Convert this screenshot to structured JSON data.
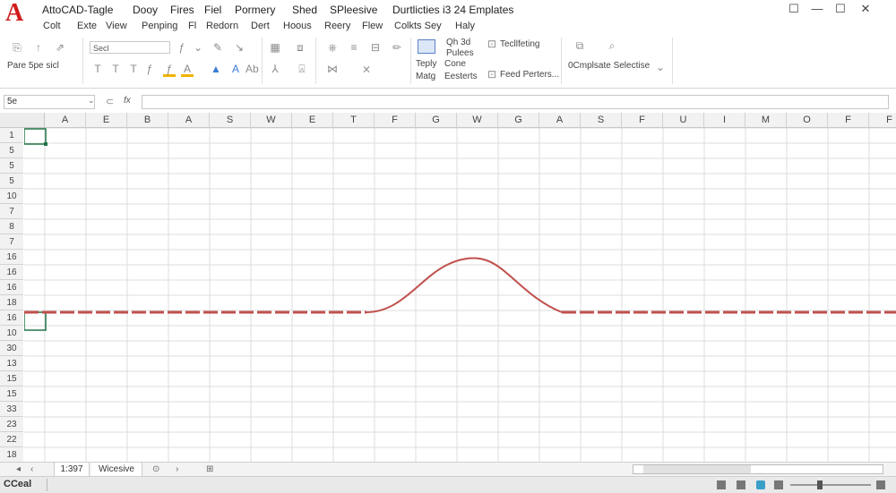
{
  "app": {
    "logo_letter": "A",
    "title": "AttoCAD-Tagle",
    "menu_top": [
      "Dooy",
      "Fires",
      "Fiel",
      "Pormery",
      "Shed",
      "SPleesive",
      "Durtlicties i3 24 Emplates"
    ],
    "menu_row2": [
      "Colt",
      "Exte",
      "View",
      "Penping",
      "Fl",
      "Redorn",
      "Dert",
      "Hoous",
      "Reery",
      "Flew",
      "Colkts Sey",
      "Haly"
    ]
  },
  "window_buttons": [
    "☐",
    "—",
    "☐",
    "✕"
  ],
  "ribbon": {
    "paste_label": "Pare 5pe sicl",
    "font_name": "Secl",
    "group_tepy": [
      "Teply",
      "Matg"
    ],
    "group_cone": [
      "Cone",
      "Eesterts"
    ],
    "group_right_top": [
      "Tecllfeting",
      "Feed Perters..."
    ],
    "dropdown_label": "0Cmplsate Selectise",
    "mid_labels": [
      "Qh 3d",
      "Pulees"
    ]
  },
  "formula_bar": {
    "name_box": "5e",
    "fx": "fx"
  },
  "grid": {
    "columns": [
      "A",
      "E",
      "B",
      "A",
      "S",
      "W",
      "E",
      "T",
      "F",
      "G",
      "W",
      "G",
      "A",
      "S",
      "F",
      "U",
      "I",
      "M",
      "O",
      "F",
      "F"
    ],
    "rows": [
      "1",
      "5",
      "5",
      "5",
      "10",
      "7",
      "8",
      "7",
      "16",
      "16",
      "16",
      "18",
      "16",
      "10",
      "30",
      "13",
      "15",
      "15",
      "33",
      "23",
      "22",
      "18"
    ],
    "accent_color": "#217346",
    "curve_color": "#c0504d"
  },
  "sheet_tabs": {
    "nav_left": "◂",
    "nav_prev": "‹",
    "tab1": "1:397",
    "tab2": "Wicesive",
    "add": "⊙",
    "nav_next": "›",
    "extra": "⊞"
  },
  "status": {
    "left": "CCeal"
  }
}
